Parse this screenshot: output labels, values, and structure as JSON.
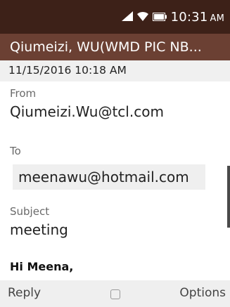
{
  "status_bar": {
    "time": "10:31",
    "ampm": "AM",
    "icons": [
      "signal-icon",
      "wifi-icon",
      "battery-icon"
    ]
  },
  "header": {
    "title": "Qiumeizi, WU(WMD PIC NB..."
  },
  "email": {
    "date": "11/15/2016 10:18 AM",
    "from_label": "From",
    "from_value": "Qiumeizi.Wu@tcl.com",
    "to_label": "To",
    "to_value": "meenawu@hotmail.com",
    "subject_label": "Subject",
    "subject_value": "meeting",
    "body_preview": "Hi Meena,"
  },
  "softkeys": {
    "left": "Reply",
    "right": "Options",
    "center_icon": "select-key-icon"
  },
  "colors": {
    "status_bar_bg": "#3d2118",
    "title_bar_bg": "#6b4033",
    "date_row_bg": "#f0f0f0",
    "softkey_bg": "#efefef"
  }
}
